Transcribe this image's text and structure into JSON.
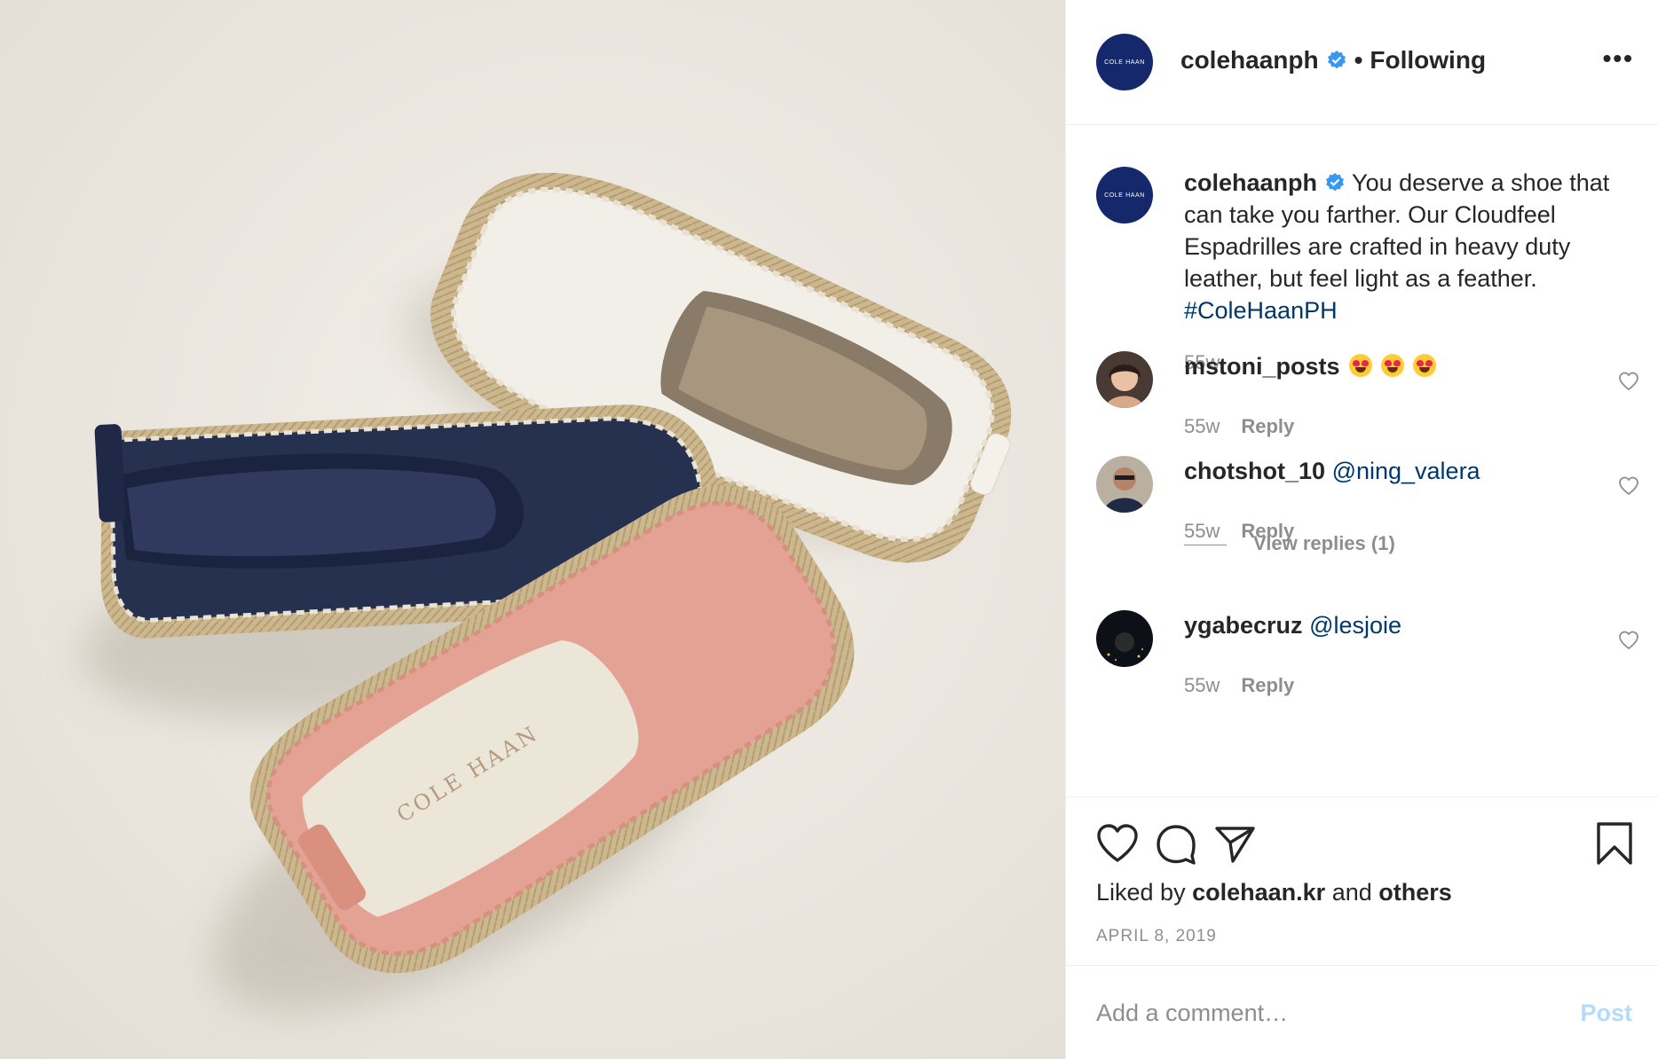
{
  "post_image": {
    "brand_print": "COLE HAAN",
    "colors": {
      "background": "#ece8e1",
      "navy": "#26304f",
      "white": "#f2efe8",
      "pink": "#e4a295",
      "jute": "#cfb990"
    }
  },
  "header": {
    "avatar_text": "COLE HAAN",
    "username": "colehaanph",
    "separator": "•",
    "follow_status": "Following",
    "more_icon": "•••"
  },
  "caption": {
    "avatar_text": "COLE HAAN",
    "username": "colehaanph",
    "text": "You deserve a shoe that can take you farther. Our Cloudfeel Espadrilles are crafted in heavy duty leather, but feel light as a feather.",
    "hashtag": "#ColeHaanPH",
    "time": "55w"
  },
  "comments": [
    {
      "username": "mstoni_posts",
      "text": "",
      "emoji_count": 3,
      "time": "55w",
      "reply_label": "Reply"
    },
    {
      "username": "chotshot_10",
      "text": "@ning_valera",
      "time": "55w",
      "reply_label": "Reply"
    },
    {
      "username": "ygabecruz",
      "text": "@lesjoie",
      "time": "55w",
      "reply_label": "Reply"
    }
  ],
  "view_replies": "View replies (1)",
  "actions": {
    "liked_prefix": "Liked by",
    "liked_user": "colehaan.kr",
    "liked_and": "and",
    "liked_others": "others",
    "date": "APRIL 8, 2019"
  },
  "add_comment": {
    "placeholder": "Add a comment…",
    "post_label": "Post"
  },
  "colors": {
    "accent_link": "#00376b",
    "verified": "#3897f0",
    "muted": "#8e8e8e",
    "post_disabled": "#b3dbff"
  }
}
